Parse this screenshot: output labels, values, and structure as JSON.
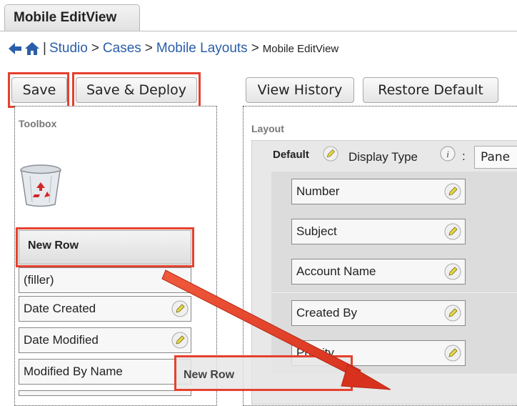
{
  "tab": {
    "label": "Mobile EditView"
  },
  "breadcrumb": {
    "separator": "|",
    "items": [
      "Studio",
      "Cases",
      "Mobile Layouts"
    ],
    "current": "Mobile EditView",
    "arrow": ">"
  },
  "buttons": {
    "save": "Save",
    "save_deploy": "Save & Deploy",
    "view_history": "View History",
    "restore_default": "Restore Default"
  },
  "toolbox": {
    "label": "Toolbox",
    "new_row": "New Row",
    "fields": [
      "(filler)",
      "Date Created",
      "Date Modified",
      "Modified By Name"
    ]
  },
  "layout": {
    "label": "Layout",
    "panel_name": "Default",
    "display_type_label": "Display Type",
    "display_type_colon": ":",
    "display_type_value": "Pane",
    "fields": [
      "Number",
      "Subject",
      "Account Name",
      "Created By",
      "Priority"
    ]
  },
  "drag": {
    "ghost_label": "New Row"
  },
  "colors": {
    "highlight": "#e5412e",
    "link": "#2a5ea8"
  }
}
